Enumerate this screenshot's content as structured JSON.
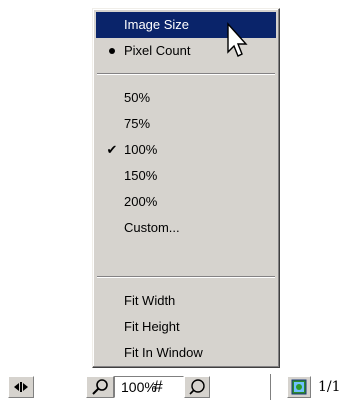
{
  "menu": {
    "items": [
      {
        "label": "Image Size",
        "mark": "",
        "highlighted": true
      },
      {
        "label": "Pixel Count",
        "mark": "bullet",
        "highlighted": false
      },
      {
        "label": "50%",
        "mark": "",
        "highlighted": false
      },
      {
        "label": "75%",
        "mark": "",
        "highlighted": false
      },
      {
        "label": "100%",
        "mark": "check",
        "highlighted": false
      },
      {
        "label": "150%",
        "mark": "",
        "highlighted": false
      },
      {
        "label": "200%",
        "mark": "",
        "highlighted": false
      },
      {
        "label": "Custom...",
        "mark": "",
        "highlighted": false
      },
      {
        "label": "Fit Width",
        "mark": "",
        "highlighted": false
      },
      {
        "label": "Fit Height",
        "mark": "",
        "highlighted": false
      },
      {
        "label": "Fit In Window",
        "mark": "",
        "highlighted": false
      }
    ],
    "check_glyph": "✔",
    "highlight_color": "#0a246a",
    "background_color": "#d6d3ce"
  },
  "statusbar": {
    "scroll_icon": "left-right-arrows-icon",
    "zoom_icon": "magnifier-icon",
    "zoom_value": "100%",
    "hash_symbol": "#",
    "zoom_menu_icon": "magnifier-icon",
    "image_icon": "image-thumbnail-icon",
    "page_count": "1/1"
  }
}
